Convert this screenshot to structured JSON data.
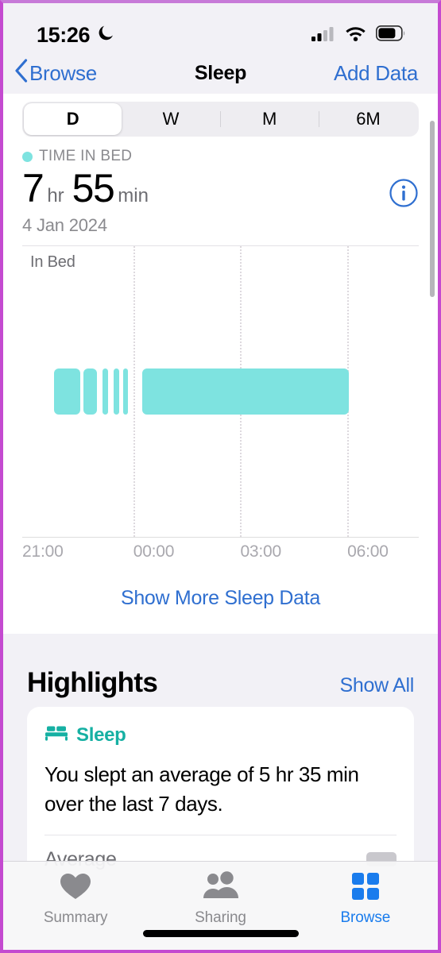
{
  "status_bar": {
    "time": "15:26",
    "dnd_icon": "crescent-moon-icon",
    "cellular_icon": "cellular-bars-icon",
    "wifi_icon": "wifi-icon",
    "battery_icon": "battery-icon"
  },
  "nav": {
    "back_label": "Browse",
    "back_icon": "chevron-left-icon",
    "title": "Sleep",
    "action_label": "Add Data"
  },
  "segmented": {
    "options": [
      "D",
      "W",
      "M",
      "6M"
    ],
    "selected": "D"
  },
  "summary": {
    "legend_label": "TIME IN BED",
    "legend_color": "#7EE3E0",
    "hours": "7",
    "hours_unit": "hr",
    "minutes": "55",
    "minutes_unit": "min",
    "date": "4 Jan 2024",
    "info_icon": "info-circle-icon"
  },
  "chart_data": {
    "type": "bar",
    "title": "Time in Bed",
    "ylabel": "In Bed",
    "xlabel": "",
    "grid": true,
    "legend": "none",
    "x_tick_labels": [
      "21:00",
      "00:00",
      "03:00",
      "06:00"
    ],
    "x_tick_positions_pct": [
      1.5,
      28.0,
      55.0,
      82.0
    ],
    "gridline_positions_pct": [
      28.0,
      55.0,
      82.0
    ],
    "axis_range": [
      "20:50",
      "08:00"
    ],
    "series": [
      {
        "name": "In Bed",
        "color": "#7EE3E0",
        "segments": [
          {
            "start_pct": 8.0,
            "width_pct": 6.6,
            "label": "22:05 - 22:50"
          },
          {
            "start_pct": 15.5,
            "width_pct": 3.3,
            "label": "23:00 - 23:25"
          },
          {
            "start_pct": 20.2,
            "width_pct": 1.4,
            "label": "23:35 - 23:45"
          },
          {
            "start_pct": 23.0,
            "width_pct": 1.4,
            "label": "23:55 - 00:05"
          },
          {
            "start_pct": 25.5,
            "width_pct": 1.1,
            "label": "00:10 - 00:18"
          },
          {
            "start_pct": 30.2,
            "width_pct": 52.2,
            "label": "00:40 - 06:15"
          }
        ]
      }
    ]
  },
  "show_more": {
    "label": "Show More Sleep Data"
  },
  "highlights": {
    "title": "Highlights",
    "show_all_label": "Show All",
    "card": {
      "category": "Sleep",
      "category_icon": "bed-icon",
      "category_color": "#16B0A3",
      "body": "You slept an average of 5 hr 35 min over the last 7 days.",
      "row_label": "Average"
    }
  },
  "tab_bar": {
    "tabs": [
      {
        "label": "Summary",
        "icon": "heart-icon",
        "active": false
      },
      {
        "label": "Sharing",
        "icon": "people-icon",
        "active": false
      },
      {
        "label": "Browse",
        "icon": "grid-icon",
        "active": true
      }
    ]
  }
}
